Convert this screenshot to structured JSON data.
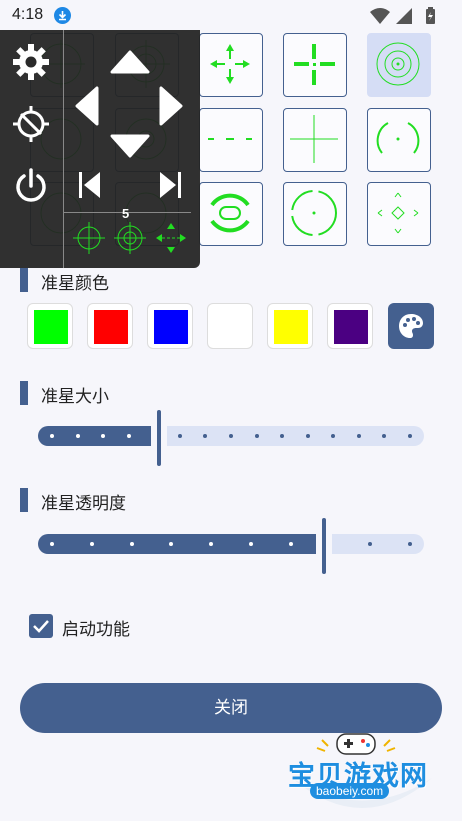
{
  "status_bar": {
    "time": "4:18"
  },
  "overlay": {
    "level": "5"
  },
  "sections": {
    "color_title": "准星颜色",
    "size_title": "准星大小",
    "opacity_title": "准星透明度"
  },
  "colors": {
    "accent": "#44608f",
    "crosshair_green": "#22dd22",
    "swatches": [
      "#00ff00",
      "#ff0000",
      "#0000ff",
      "#ffffff",
      "#ffff00",
      "#4b0082"
    ]
  },
  "size_slider": {
    "value_fraction": 0.3,
    "step_count": 15
  },
  "opacity_slider": {
    "value_fraction": 0.76,
    "step_count": 10
  },
  "enable_feature": {
    "label": "启动功能",
    "checked": true
  },
  "close_button": {
    "label": "关闭"
  },
  "watermark": {
    "title": "宝贝游戏网",
    "url": "baobeiy.com"
  },
  "icons": {
    "overlay_left": [
      "gear-icon",
      "crosshair-off-icon",
      "power-icon"
    ],
    "overlay_dpad": [
      "arrow-up-icon",
      "arrow-left-icon",
      "arrow-right-icon",
      "arrow-down-icon"
    ],
    "overlay_nav": [
      "skip-previous-icon",
      "skip-next-icon"
    ],
    "palette": "palette-icon"
  }
}
